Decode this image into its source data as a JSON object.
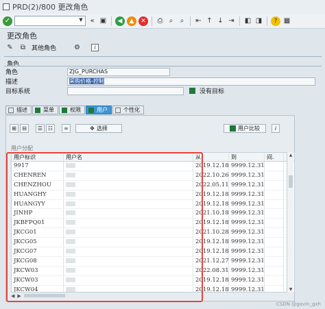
{
  "window": {
    "title": "PRD(2)/800 更改角色"
  },
  "app": {
    "title": "更改角色",
    "other_role_label": "其他角色"
  },
  "role_section": {
    "section_label": "角色",
    "role_label": "角色",
    "role_value": "ZJG_PURCHAS",
    "desc_label": "描述",
    "desc_value": "采购价格-控制",
    "target_label": "目标系统",
    "target_value": "",
    "no_target_label": "没有目标"
  },
  "tabs": [
    {
      "label": "描述"
    },
    {
      "label": "菜单"
    },
    {
      "label": "权限"
    },
    {
      "label": "用户"
    },
    {
      "label": "个性化"
    }
  ],
  "buttons": {
    "select_label": "选择",
    "compare_label": "用户比较"
  },
  "user_table": {
    "group_label": "用户分配",
    "headers": [
      "用户标识",
      "用户名",
      "从",
      "到",
      "间."
    ],
    "rows": [
      {
        "id": "9917",
        "name": "",
        "from": "2019.12.18",
        "to": "9999.12.31"
      },
      {
        "id": "CHENREN",
        "name": "",
        "from": "2022.10.26",
        "to": "9999.12.31"
      },
      {
        "id": "CHENZHOU",
        "name": "",
        "from": "2022.05.11",
        "to": "9999.12.31"
      },
      {
        "id": "HUANGHY",
        "name": "",
        "from": "2019.12.18",
        "to": "9999.12.31"
      },
      {
        "id": "HUANGYY",
        "name": "",
        "from": "2019.12.18",
        "to": "9999.12.31"
      },
      {
        "id": "JINHP",
        "name": "",
        "from": "2021.10.18",
        "to": "9999.12.31"
      },
      {
        "id": "JKBFPQ01",
        "name": "",
        "from": "2019.12.18",
        "to": "9999.12.31"
      },
      {
        "id": "JKCG01",
        "name": "",
        "from": "2021.10.28",
        "to": "9999.12.31"
      },
      {
        "id": "JKCG05",
        "name": "",
        "from": "2019.12.18",
        "to": "9999.12.31"
      },
      {
        "id": "JKCG07",
        "name": "",
        "from": "2019.12.18",
        "to": "9999.12.31"
      },
      {
        "id": "JKCG08",
        "name": "",
        "from": "2021.12.27",
        "to": "9999.12.31"
      },
      {
        "id": "JKCW03",
        "name": "",
        "from": "2022.08.31",
        "to": "9999.12.31"
      },
      {
        "id": "JKCW03",
        "name": "",
        "from": "2019.12.18",
        "to": "9999.12.31"
      },
      {
        "id": "JKCW04",
        "name": "",
        "from": "2019.12.18",
        "to": "9999.12.31"
      }
    ]
  },
  "watermark": "CSDN @gavin_gxh",
  "colors": {
    "active_tab": "#3f95d1",
    "highlight_box": "#e8423c",
    "status_green": "#1e7a37"
  }
}
